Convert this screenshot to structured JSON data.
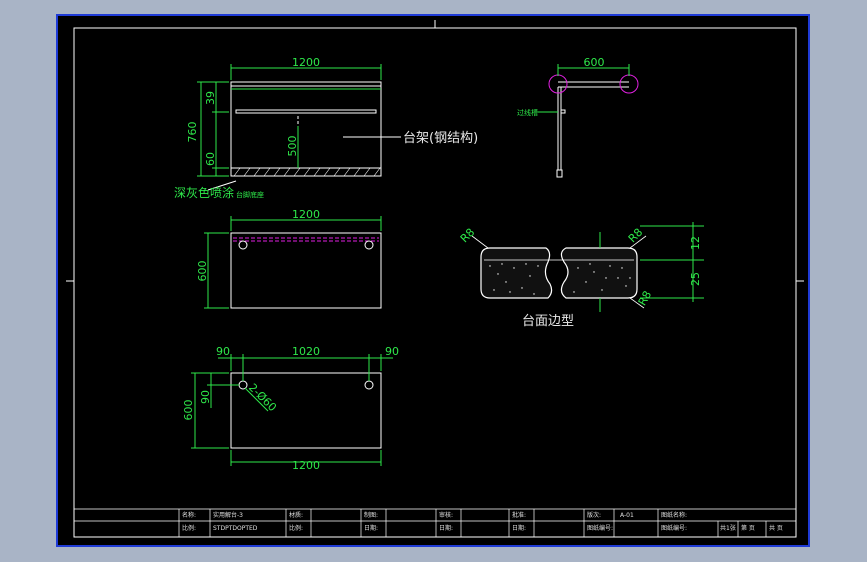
{
  "drawing": {
    "front_view": {
      "width_dim": "1200",
      "height_dims": [
        "760",
        "39",
        "60",
        "500"
      ],
      "leader_label": "台架(钢结构)",
      "bottom_note_large": "深灰色喷涂",
      "bottom_note_small": "台脚底座"
    },
    "top_view": {
      "width_dim": "1200",
      "depth_dim": "600"
    },
    "base_view": {
      "edge_left": "90",
      "middle": "1020",
      "edge_right": "90",
      "depth_dim": "600",
      "offset_dim": "90",
      "hole_note": "2-Ø60",
      "width_dim": "1200"
    },
    "side_view": {
      "width_dim": "600",
      "small_label": "过线槽"
    },
    "edge_profile": {
      "title": "台面边型",
      "radius_labels": [
        "R8",
        "R8",
        "R8"
      ],
      "thickness_dims": [
        "12",
        "25"
      ]
    }
  },
  "title_block": {
    "row1": [
      "名称:",
      "实用解台-3",
      "材质:",
      "",
      "制图:",
      "",
      "审核:",
      "",
      "批准:",
      "",
      "版次:",
      "A-01",
      "图纸名称:",
      ""
    ],
    "row2": [
      "比例:",
      "STDPTDOPTED",
      "比例:",
      "",
      "日期:",
      "",
      "日期:",
      "",
      "日期:",
      "",
      "图纸编号:",
      "",
      "图纸编号:",
      "",
      "共1张",
      "第  页",
      "共  页"
    ]
  },
  "colors": {
    "background": "#000000",
    "border": "#1f3bd6",
    "geometry": "#ffffff",
    "dimension": "#2ee84a",
    "accent": "#e020e0"
  }
}
